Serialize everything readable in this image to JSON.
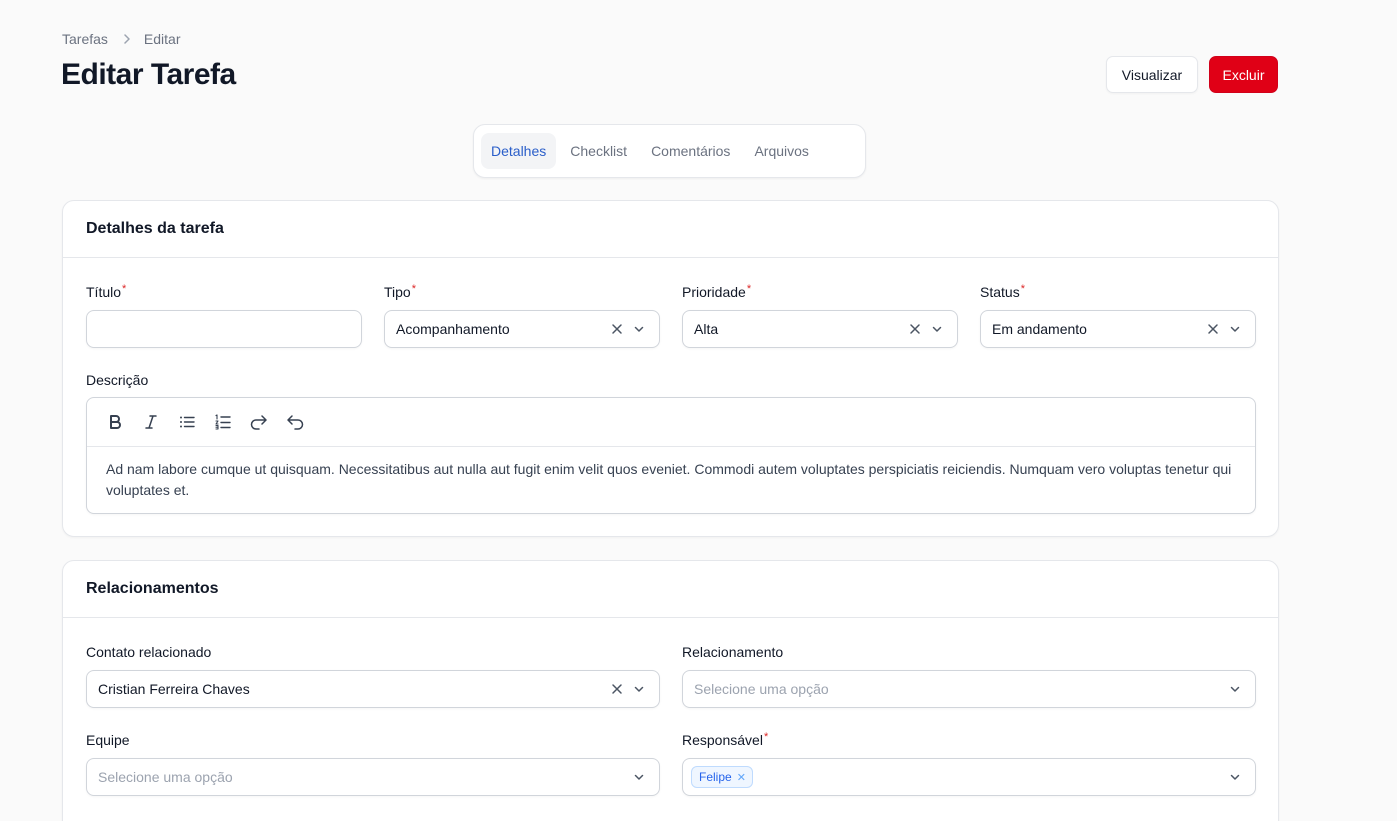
{
  "breadcrumb": {
    "parent": "Tarefas",
    "current": "Editar"
  },
  "page_title": "Editar Tarefa",
  "actions": {
    "view": "Visualizar",
    "delete": "Excluir"
  },
  "tabs": [
    {
      "label": "Detalhes",
      "active": true
    },
    {
      "label": "Checklist",
      "active": false
    },
    {
      "label": "Comentários",
      "active": false
    },
    {
      "label": "Arquivos",
      "active": false
    }
  ],
  "details": {
    "heading": "Detalhes da tarefa",
    "titulo": {
      "label": "Título",
      "value": ""
    },
    "tipo": {
      "label": "Tipo",
      "value": "Acompanhamento"
    },
    "prioridade": {
      "label": "Prioridade",
      "value": "Alta"
    },
    "status": {
      "label": "Status",
      "value": "Em andamento"
    },
    "descricao": {
      "label": "Descrição",
      "text": "Ad nam labore cumque ut quisquam. Necessitatibus aut nulla aut fugit enim velit quos eveniet. Commodi autem voluptates perspiciatis reiciendis. Numquam vero voluptas tenetur qui voluptates et."
    }
  },
  "relations": {
    "heading": "Relacionamentos",
    "contato": {
      "label": "Contato relacionado",
      "value": "Cristian Ferreira Chaves"
    },
    "relacionamento": {
      "label": "Relacionamento",
      "placeholder": "Selecione uma opção"
    },
    "equipe": {
      "label": "Equipe",
      "placeholder": "Selecione uma opção"
    },
    "responsavel": {
      "label": "Responsável",
      "chips": [
        "Felipe"
      ]
    }
  },
  "required_mark": "*",
  "colors": {
    "accent": "#2a5ec9",
    "danger": "#e00016",
    "required": "#dc2626"
  }
}
